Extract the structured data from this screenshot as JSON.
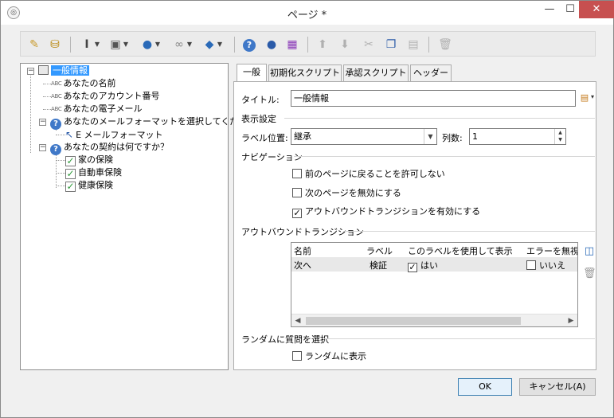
{
  "window": {
    "title": "ページ *",
    "min_glyph": "—",
    "max_glyph": "☐",
    "close_glyph": "✕"
  },
  "toolbar": {
    "icons": [
      "wand-icon",
      "database-icon",
      "text-cursor-icon",
      "add-field-icon",
      "globe-icon",
      "link-icon",
      "package-icon",
      "help-icon",
      "user-icon",
      "add-item-icon",
      "arrow-up-icon",
      "arrow-down-icon",
      "shuffle-icon",
      "copy-icon",
      "paste-icon",
      "delete-icon"
    ],
    "colors": {
      "blue": "#3f78c8",
      "green": "#2e9a3a",
      "gray": "#9c9c9c",
      "purple": "#8a3ab8"
    }
  },
  "tree": {
    "root": "一般情報",
    "items": [
      {
        "type": "abc",
        "abc": "ABC",
        "label": "あなたの名前"
      },
      {
        "type": "abc",
        "abc": "ABC",
        "label": "あなたのアカウント番号"
      },
      {
        "type": "abc",
        "abc": "ABC",
        "label": "あなたの電子メール"
      },
      {
        "type": "question",
        "label": "あなたのメールフォーマットを選択してください"
      },
      {
        "type": "choice",
        "label": "E メールフォーマット"
      },
      {
        "type": "question",
        "label": "あなたの契約は何ですか？"
      },
      {
        "type": "check",
        "label": "家の保険"
      },
      {
        "type": "check",
        "label": "自動車保険"
      },
      {
        "type": "check",
        "label": "健康保険"
      }
    ]
  },
  "tabs": [
    {
      "label": "一般",
      "active": true
    },
    {
      "label": "初期化スクリプト",
      "active": false
    },
    {
      "label": "承認スクリプト",
      "active": false
    },
    {
      "label": "ヘッダー",
      "active": false
    }
  ],
  "general": {
    "title_label": "タイトル:",
    "title_value": "一般情報",
    "display_section": "表示設定",
    "label_position_label": "ラベル位置:",
    "label_position_value": "継承",
    "columns_label": "列数:",
    "columns_value": "1",
    "navigation_section": "ナビゲーション",
    "nav_options": [
      {
        "label": "前のページに戻ることを許可しない",
        "checked": false
      },
      {
        "label": "次のページを無効にする",
        "checked": false
      },
      {
        "label": "アウトバウンドトランジションを有効にする",
        "checked": true
      }
    ],
    "outbound_section": "アウトバウンドトランジション",
    "grid_headers": [
      "名前",
      "ラベル",
      "このラベルを使用して表示",
      "エラーを無視"
    ],
    "grid_rows": [
      {
        "name": "次へ",
        "label": "検証",
        "show": "はい",
        "show_checked": true,
        "ignore": "いいえ",
        "ignore_checked": false
      }
    ],
    "random_section": "ランダムに質問を選択",
    "random_option": {
      "label": "ランダムに表示",
      "checked": false
    }
  },
  "buttons": {
    "ok": "OK",
    "cancel": "キャンセル(A)"
  }
}
